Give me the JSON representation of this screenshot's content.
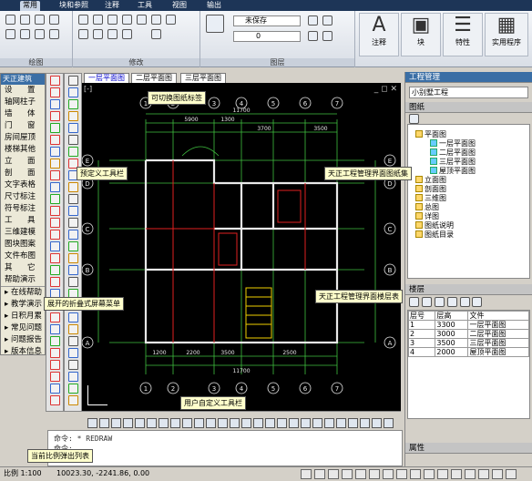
{
  "ribbon": {
    "tabs": [
      "常用",
      "块和参照",
      "注释",
      "工具",
      "视图",
      "输出"
    ],
    "groups": {
      "draw": "绘图",
      "modify": "修改",
      "layers": "图层"
    },
    "layer_combo": "未保存",
    "layer_combo2": "0",
    "big_buttons": [
      "注释",
      "块",
      "特性",
      "实用程序"
    ]
  },
  "palette": {
    "title": "天正建筑",
    "items": [
      "设　置",
      "轴网柱子",
      "墙　体",
      "门　窗",
      "房间屋顶",
      "楼梯其他",
      "立　面",
      "剖　面",
      "文字表格",
      "尺寸标注",
      "符号标注",
      "工　具",
      "三维建模",
      "图块图案",
      "文件布图",
      "其　它",
      "帮助演示"
    ],
    "extra": [
      "在线帮助",
      "教学演示",
      "日积月累",
      "常见问题",
      "问题报告",
      "版本信息"
    ]
  },
  "drawing": {
    "tabs": [
      "一层平面图",
      "二层平面图",
      "三层平面图"
    ],
    "dims_top": [
      "11700",
      "5900",
      "1300",
      "3700",
      "3500"
    ],
    "axes_top": [
      "1",
      "2",
      "3",
      "4",
      "5",
      "6",
      "7"
    ],
    "axes_left": [
      "A",
      "B",
      "C",
      "D",
      "E"
    ],
    "dims_bottom": [
      "1200",
      "2200",
      "3500",
      "2500",
      "11700"
    ],
    "scale": "1:100"
  },
  "callouts": {
    "tabs": "可切换图纸标签",
    "custom_toolbar": "预定义工具栏",
    "project_mgr": "天正工程管理界面图纸集",
    "screen_menu": "展开的折叠式屏幕菜单",
    "floor_table": "天正工程管理界面楼层表",
    "user_toolbar": "用户自定义工具栏",
    "scale_list": "当前比例弹出列表"
  },
  "command": {
    "line1": "命令: * REDRAW",
    "line2": "命令:"
  },
  "status": {
    "scale": "比例 1:100",
    "coords": "10023.30, -2241.86, 0.00"
  },
  "project": {
    "panel_title": "工程管理",
    "name": "小别墅工程",
    "sheets_header": "图纸",
    "tree": [
      {
        "label": "平面图",
        "level": 0
      },
      {
        "label": "一层平面图",
        "level": 1
      },
      {
        "label": "二层平面图",
        "level": 1
      },
      {
        "label": "三层平面图",
        "level": 1
      },
      {
        "label": "屋顶平面图",
        "level": 1
      },
      {
        "label": "立面图",
        "level": 0
      },
      {
        "label": "剖面图",
        "level": 0
      },
      {
        "label": "三维图",
        "level": 0
      },
      {
        "label": "总图",
        "level": 0
      },
      {
        "label": "详图",
        "level": 0
      },
      {
        "label": "图纸说明",
        "level": 0
      },
      {
        "label": "图纸目录",
        "level": 0
      }
    ],
    "floors_header": "楼层",
    "floor_cols": [
      "层号",
      "层高",
      "文件"
    ],
    "floors": [
      [
        "1",
        "3300",
        "一层平面图"
      ],
      [
        "2",
        "3000",
        "二层平面图"
      ],
      [
        "3",
        "3500",
        "三层平面图"
      ],
      [
        "4",
        "2000",
        "屋顶平面图"
      ]
    ],
    "props_header": "属性"
  },
  "colors": {
    "ribbon_dark": "#1d3557",
    "canvas": "#000000",
    "plan_green": "#3fbf3f",
    "plan_red": "#e02020",
    "callout": "#ffffcc"
  }
}
